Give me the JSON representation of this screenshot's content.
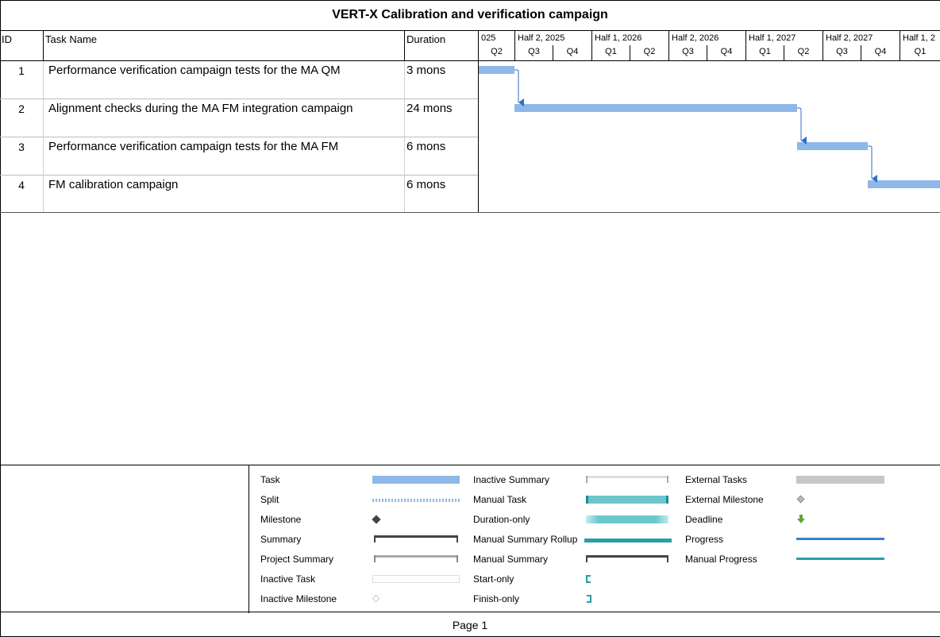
{
  "title": "VERT-X Calibration and verification campaign",
  "columns": {
    "id": "ID",
    "task_name": "Task Name",
    "duration": "Duration"
  },
  "timescale": {
    "halves": [
      "025",
      "Half 2, 2025",
      "Half 1, 2026",
      "Half 2, 2026",
      "Half 1, 2027",
      "Half 2, 2027",
      "Half 1, 2"
    ],
    "quarters": [
      "Q2",
      "Q3",
      "Q4",
      "Q1",
      "Q2",
      "Q3",
      "Q4",
      "Q1",
      "Q2",
      "Q3",
      "Q4",
      "Q1"
    ]
  },
  "tasks": [
    {
      "id": "1",
      "name": "Performance verification campaign tests for the MA QM",
      "duration": "3 mons",
      "start_quarter": "Q2 2025",
      "quarters": 1
    },
    {
      "id": "2",
      "name": "Alignment checks during the MA FM integration campaign",
      "duration": "24 mons",
      "start_quarter": "Q3 2025",
      "quarters": 8
    },
    {
      "id": "3",
      "name": "Performance verification campaign tests for the MA FM",
      "duration": "6 mons",
      "start_quarter": "Q2 2027",
      "quarters": 2
    },
    {
      "id": "4",
      "name": "FM calibration campaign",
      "duration": "6 mons",
      "start_quarter": "Q4 2027",
      "quarters": 2
    }
  ],
  "legend": {
    "col1": [
      "Task",
      "Split",
      "Milestone",
      "Summary",
      "Project Summary",
      "Inactive Task",
      "Inactive Milestone"
    ],
    "col2": [
      "Inactive Summary",
      "Manual Task",
      "Duration-only",
      "Manual Summary Rollup",
      "Manual Summary",
      "Start-only",
      "Finish-only"
    ],
    "col3": [
      "External Tasks",
      "External Milestone",
      "Deadline",
      "Progress",
      "Manual Progress"
    ]
  },
  "colors": {
    "task_bar": "#8db8e8",
    "link_arrow": "#2f6fc4",
    "manual": "#6cc7cc",
    "manual_dark": "#2a9ea6",
    "progress": "#3a7fd5"
  },
  "footer": {
    "page": "Page 1"
  }
}
